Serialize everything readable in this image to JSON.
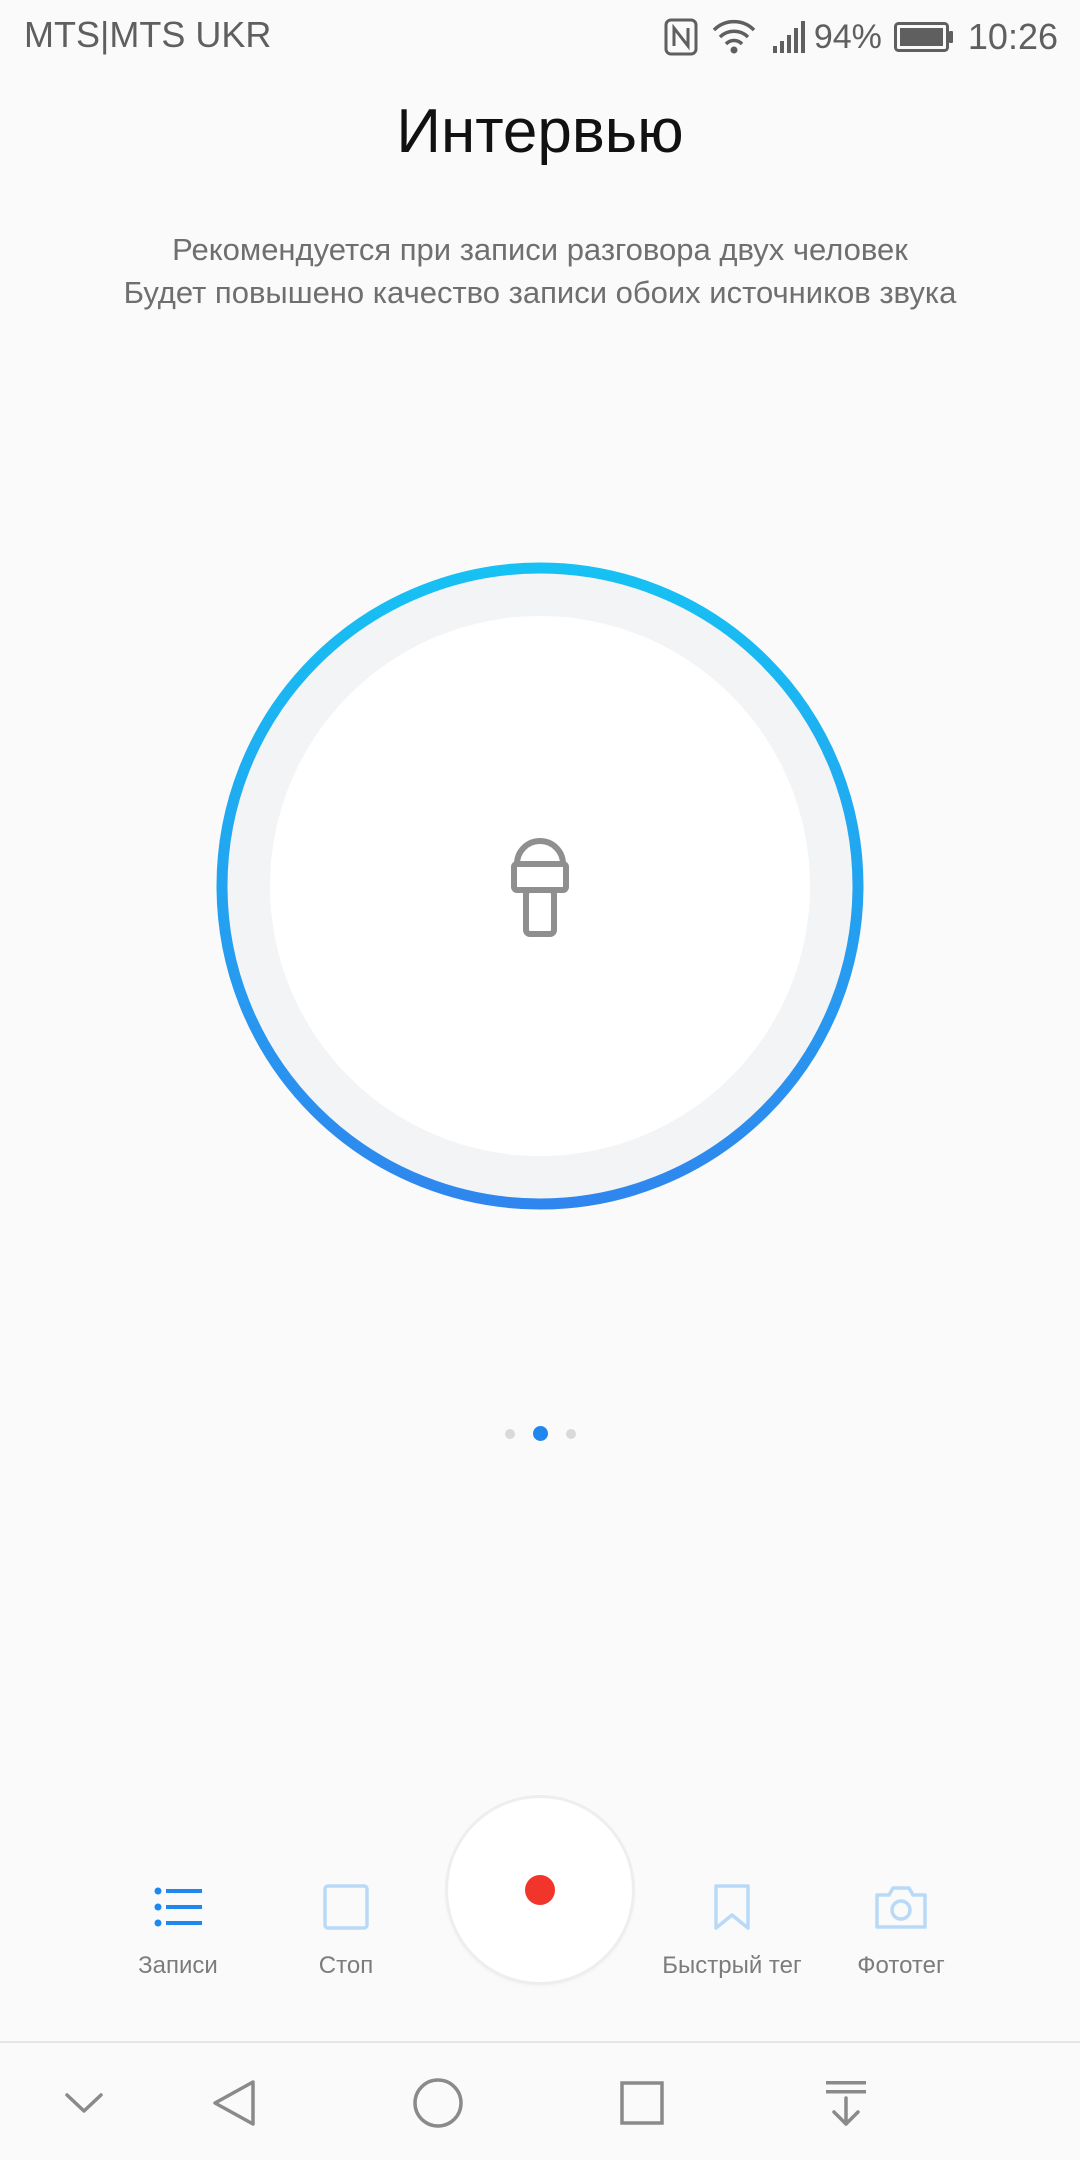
{
  "status_bar": {
    "carrier": "MTS|MTS UKR",
    "battery_percent": "94%",
    "time": "10:26",
    "icons": [
      "nfc-icon",
      "wifi-icon",
      "signal-icon",
      "battery-icon"
    ]
  },
  "header": {
    "title": "Интервью",
    "description_line1": "Рекомендуется при записи разговора двух человек",
    "description_line2": "Будет повышено качество записи обоих источников звука"
  },
  "mode": {
    "icon": "microphone-icon",
    "ring_gradient_start": "#16c1f3",
    "ring_gradient_end": "#2f86ee",
    "inner_ring_color": "#f3f4f6"
  },
  "pager": {
    "count": 3,
    "active_index": 1
  },
  "toolbar": {
    "records_label": "Записи",
    "stop_label": "Стоп",
    "quick_tag_label": "Быстрый тег",
    "photo_tag_label": "Фототег",
    "record_color": "#f2352a",
    "accent_color": "#1e88f0",
    "disabled_icon_color": "#b9d9f8"
  },
  "nav_bar": {
    "icons": [
      "chevron-down-icon",
      "back-icon",
      "home-icon",
      "recents-icon",
      "notification-pull-icon"
    ]
  }
}
